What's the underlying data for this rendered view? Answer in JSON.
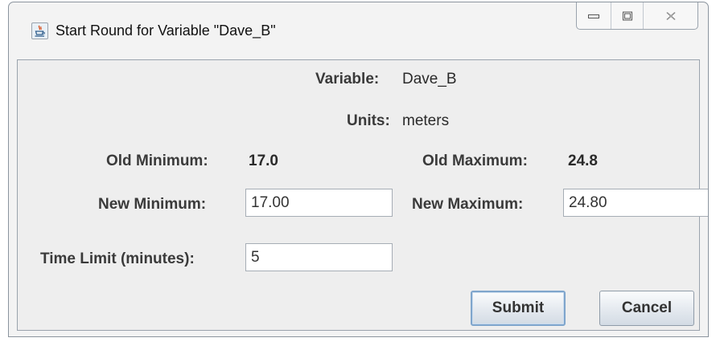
{
  "window": {
    "title": "Start Round for Variable \"Dave_B\"",
    "app_icon": "java-cup-icon"
  },
  "title_controls": {
    "minimize_icon": "minimize-icon",
    "maximize_icon": "maximize-icon",
    "close_icon": "close-icon"
  },
  "info": {
    "variable_label": "Variable:",
    "variable_value": "Dave_B",
    "units_label": "Units:",
    "units_value": "meters",
    "old_min_label": "Old Minimum:",
    "old_min_value": "17.0",
    "old_max_label": "Old Maximum:",
    "old_max_value": "24.8"
  },
  "form": {
    "new_min_label": "New Minimum:",
    "new_min_value": "17.00",
    "new_max_label": "New Maximum:",
    "new_max_value": "24.80",
    "time_limit_label": "Time Limit (minutes):",
    "time_limit_value": "5"
  },
  "buttons": {
    "submit": "Submit",
    "cancel": "Cancel"
  }
}
